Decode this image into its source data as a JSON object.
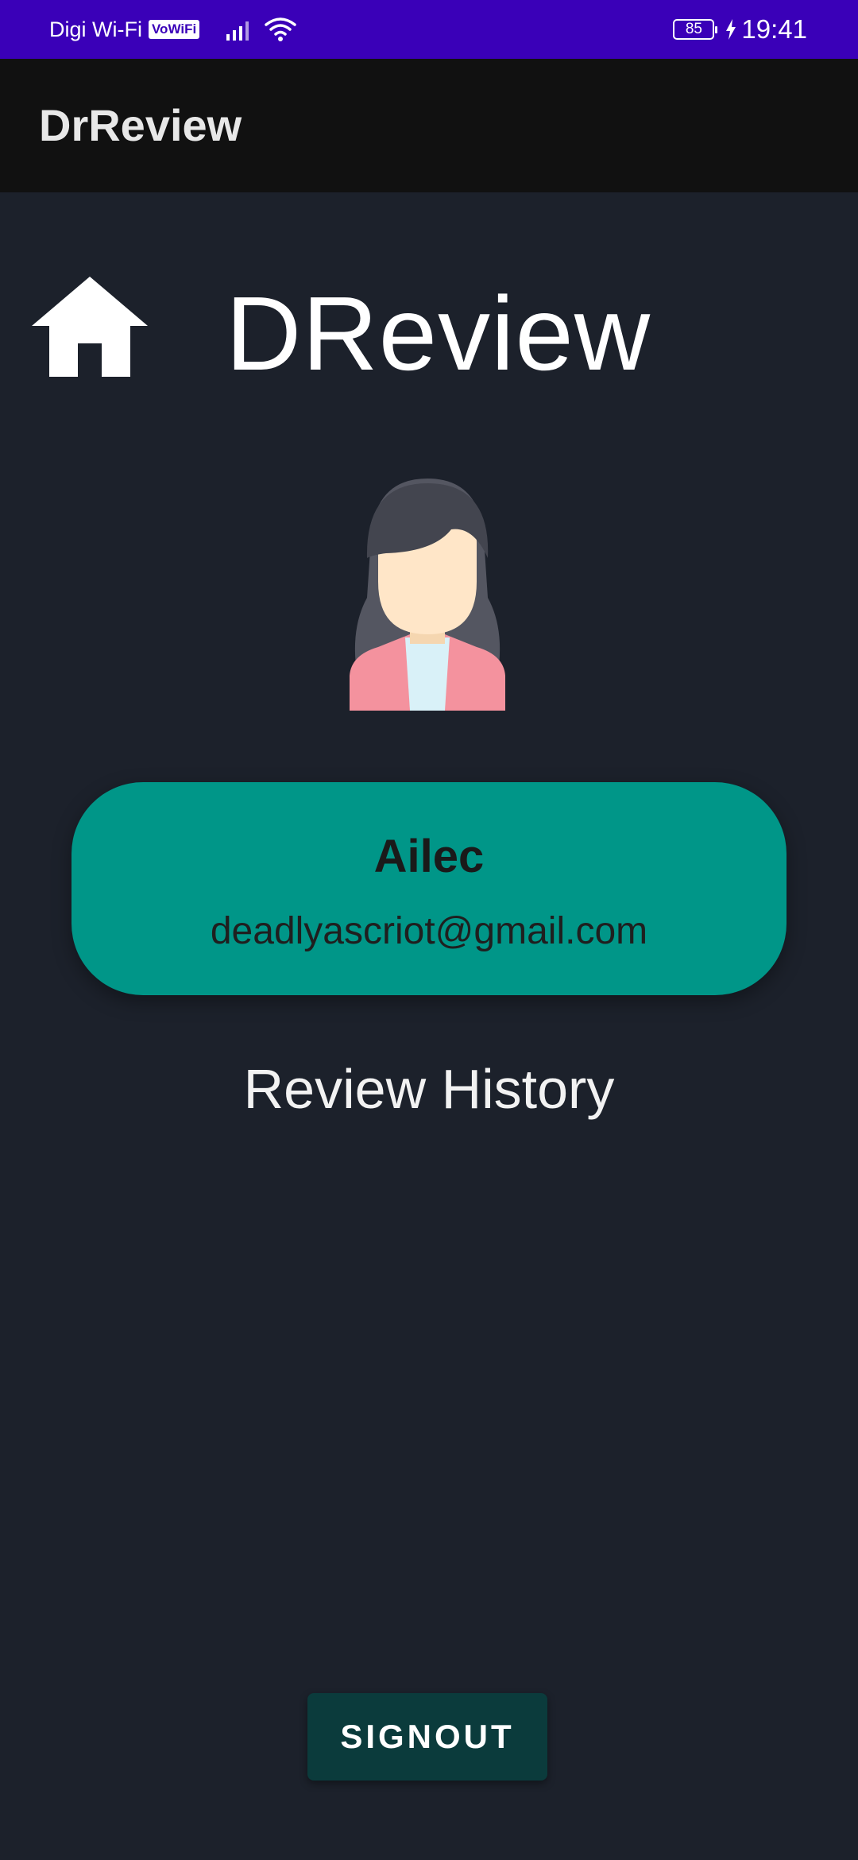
{
  "status_bar": {
    "carrier": "Digi Wi-Fi",
    "vowifi_badge": "VoWiFi",
    "battery_level": "85",
    "time": "19:41",
    "icons": [
      "signal-icon",
      "wifi-icon",
      "battery-icon",
      "charging-bolt-icon"
    ]
  },
  "app_bar": {
    "title": "DrReview"
  },
  "header": {
    "home_icon": "home-icon",
    "brand": "DReview"
  },
  "profile": {
    "avatar_icon": "female-avatar-icon",
    "name": "Ailec",
    "email": "deadlyascriot@gmail.com"
  },
  "review_history": {
    "title": "Review History"
  },
  "actions": {
    "signout_label": "SIGNOUT"
  },
  "colors": {
    "status_bar": "#3a00b8",
    "app_bar": "#111111",
    "background": "#1c212b",
    "card": "#009688",
    "signout_button": "#0b3b3c"
  }
}
